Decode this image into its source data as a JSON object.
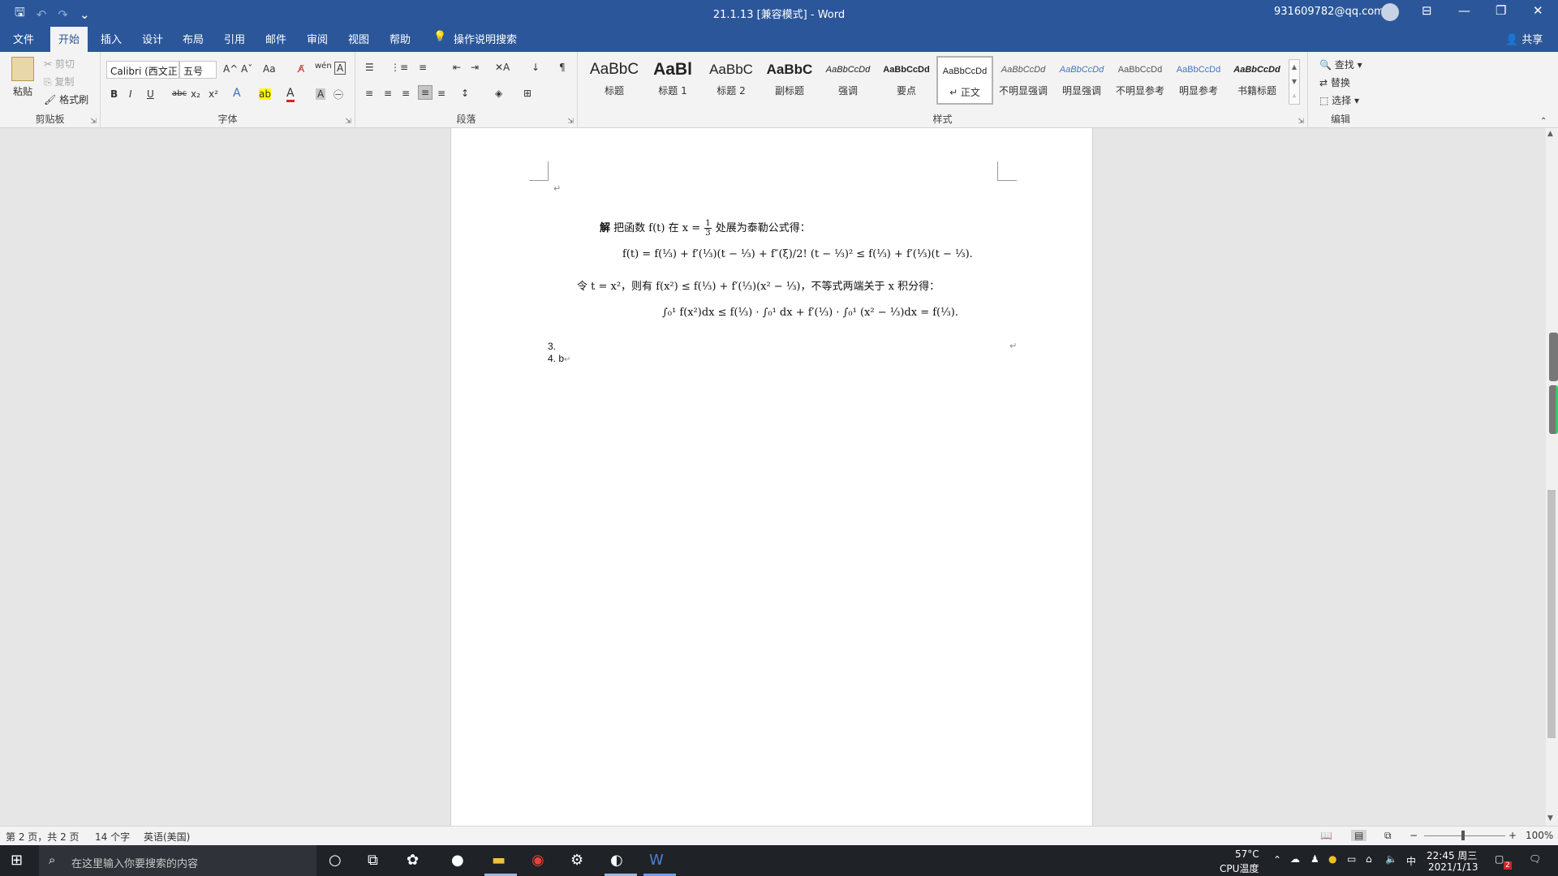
{
  "window": {
    "title": "21.1.13 [兼容模式] - Word",
    "account": "931609782@qq.com"
  },
  "qat": {
    "save": "🖫",
    "undo": "↶",
    "redo": "↷",
    "customize": "⌄"
  },
  "window_buttons": {
    "ribbon_display": "⊟",
    "minimize": "—",
    "restore": "❐",
    "close": "✕"
  },
  "tabs": [
    {
      "label": "文件"
    },
    {
      "label": "开始"
    },
    {
      "label": "插入"
    },
    {
      "label": "设计"
    },
    {
      "label": "布局"
    },
    {
      "label": "引用"
    },
    {
      "label": "邮件"
    },
    {
      "label": "审阅"
    },
    {
      "label": "视图"
    },
    {
      "label": "帮助"
    },
    {
      "label": "操作说明搜索"
    }
  ],
  "share": "共享",
  "clipboard": {
    "paste": "粘贴",
    "cut": "剪切",
    "copy": "复制",
    "format_painter": "格式刷",
    "group": "剪贴板"
  },
  "font": {
    "name": "Calibri (西文正",
    "size": "五号",
    "grow": "A^",
    "shrink": "Aˇ",
    "change_case": "Aa",
    "clear": "A̸",
    "phonetic": "wén",
    "border": "A",
    "bold": "B",
    "italic": "I",
    "underline": "U",
    "strike": "abc",
    "sub": "x₂",
    "sup": "x²",
    "effects": "A",
    "highlight": "ab",
    "color": "A",
    "shade": "A",
    "enclose": "㊀",
    "group": "字体"
  },
  "paragraph": {
    "group": "段落",
    "row1": [
      "☰",
      "⋮≡",
      "≡",
      "⇤",
      "⇥",
      "✕A",
      "↓",
      "¶"
    ],
    "row2": [
      "≡",
      "≡",
      "≡",
      "≡",
      "≡",
      "↕",
      "◈",
      "⊞"
    ]
  },
  "styles": {
    "group": "样式",
    "items": [
      {
        "sample": "AaBbC",
        "name": "标题"
      },
      {
        "sample": "AaBl",
        "name": "标题 1"
      },
      {
        "sample": "AaBbC",
        "name": "标题 2"
      },
      {
        "sample": "AaBbC",
        "name": "副标题"
      },
      {
        "sample": "AaBbCcDd",
        "name": "强调"
      },
      {
        "sample": "AaBbCcDd",
        "name": "要点"
      },
      {
        "sample": "AaBbCcDd",
        "name": "↵ 正文"
      },
      {
        "sample": "AaBbCcDd",
        "name": "不明显强调"
      },
      {
        "sample": "AaBbCcDd",
        "name": "明显强调"
      },
      {
        "sample": "AaBbCcDd",
        "name": "不明显参考"
      },
      {
        "sample": "AaBbCcDd",
        "name": "明显参考"
      },
      {
        "sample": "AaBbCcDd",
        "name": "书籍标题"
      }
    ]
  },
  "editing": {
    "find": "查找",
    "replace": "替换",
    "select": "选择",
    "group": "编辑"
  },
  "document": {
    "line1_label": "解",
    "line1_text": "把函数 f(t) 在 x =",
    "line1_tail": "处展为泰勒公式得：",
    "line2": "f(t) = f(⅓) + f′(⅓)(t − ⅓) + f″(ξ)/2! (t − ⅓)² ≤ f(⅓) + f′(⅓)(t − ⅓).",
    "line3": "令 t = x²，则有 f(x²) ≤ f(⅓) + f′(⅓)(x² − ⅓)，不等式两端关于 x 积分得：",
    "line4": "∫₀¹ f(x²)dx ≤ f(⅓) · ∫₀¹ dx + f′(⅓) · ∫₀¹ (x² − ⅓)dx = f(⅓).",
    "list": [
      "3.",
      "4. b"
    ],
    "para_mark": "↵"
  },
  "status": {
    "page": "第 2 页，共 2 页",
    "words": "14 个字",
    "language": "英语(美国)",
    "zoom": "100%",
    "zoom_value": 1.0
  },
  "taskbar": {
    "search_placeholder": "在这里输入你要搜索的内容",
    "temp": "57°C",
    "temp_label": "CPU温度",
    "ime": "中",
    "time": "22:45 周三",
    "date": "2021/1/13",
    "notif_count": "2"
  }
}
